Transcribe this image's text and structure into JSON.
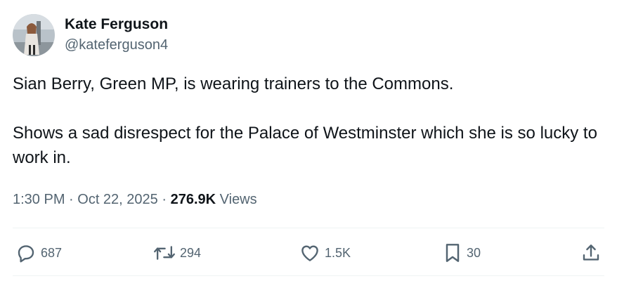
{
  "author": {
    "display_name": "Kate Ferguson",
    "handle": "@kateferguson4"
  },
  "tweet": {
    "paragraph_1": "Sian Berry, Green MP, is wearing trainers to the Commons.",
    "paragraph_2": "Shows a sad disrespect for the Palace of Westminster which she is so lucky to work in.",
    "time": "1:30 PM",
    "separator": " · ",
    "date": "Oct 22, 2025",
    "views_count": "276.9K",
    "views_label": "Views"
  },
  "actions": {
    "replies": "687",
    "reposts": "294",
    "likes": "1.5K",
    "bookmarks": "30"
  },
  "icons": {
    "reply": "reply-icon",
    "repost": "repost-icon",
    "like": "heart-icon",
    "bookmark": "bookmark-icon",
    "share": "share-icon"
  },
  "colors": {
    "text": "#0f1419",
    "secondary": "#536471",
    "divider": "#eff3f4"
  }
}
